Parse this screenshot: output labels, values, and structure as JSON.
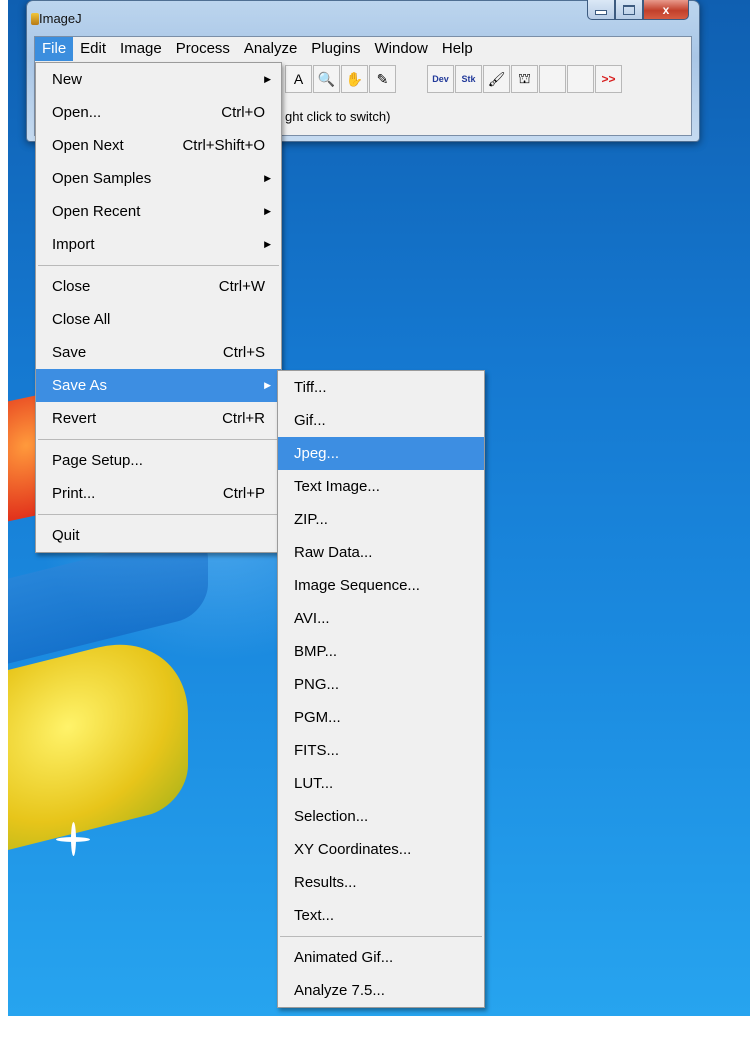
{
  "window": {
    "title": "ImageJ",
    "buttons": {
      "minimize": "–",
      "maximize": "□",
      "close": "x"
    }
  },
  "menubar": [
    "File",
    "Edit",
    "Image",
    "Process",
    "Analyze",
    "Plugins",
    "Window",
    "Help"
  ],
  "toolbar": {
    "items": [
      {
        "name": "text-tool",
        "glyph": "A"
      },
      {
        "name": "magnifier-tool",
        "glyph": "🔍"
      },
      {
        "name": "hand-tool",
        "glyph": "✋"
      },
      {
        "name": "dropper-tool",
        "glyph": "✎"
      },
      {
        "name": "dev",
        "glyph": "Dev"
      },
      {
        "name": "stk",
        "glyph": "Stk"
      },
      {
        "name": "brush-tool",
        "glyph": "🖌"
      },
      {
        "name": "flood-fill-tool",
        "glyph": "⛫"
      },
      {
        "name": "more-tools",
        "glyph": ">>"
      }
    ]
  },
  "status_text": "ght click to switch)",
  "file_menu": {
    "new": "New",
    "open": "Open...",
    "open_shortcut": "Ctrl+O",
    "open_next": "Open Next",
    "open_next_shortcut": "Ctrl+Shift+O",
    "open_samples": "Open Samples",
    "open_recent": "Open Recent",
    "import": "Import",
    "close": "Close",
    "close_shortcut": "Ctrl+W",
    "close_all": "Close All",
    "save": "Save",
    "save_shortcut": "Ctrl+S",
    "save_as": "Save As",
    "revert": "Revert",
    "revert_shortcut": "Ctrl+R",
    "page_setup": "Page Setup...",
    "print": "Print...",
    "print_shortcut": "Ctrl+P",
    "quit": "Quit"
  },
  "save_as_menu": [
    "Tiff...",
    "Gif...",
    "Jpeg...",
    "Text Image...",
    "ZIP...",
    "Raw Data...",
    "Image Sequence...",
    "AVI...",
    "BMP...",
    "PNG...",
    "PGM...",
    "FITS...",
    "LUT...",
    "Selection...",
    "XY Coordinates...",
    "Results...",
    "Text...",
    "Animated Gif...",
    "Analyze 7.5..."
  ],
  "colors": {
    "highlight": "#3d8ee2",
    "menu_bg": "#f0f0f0"
  }
}
